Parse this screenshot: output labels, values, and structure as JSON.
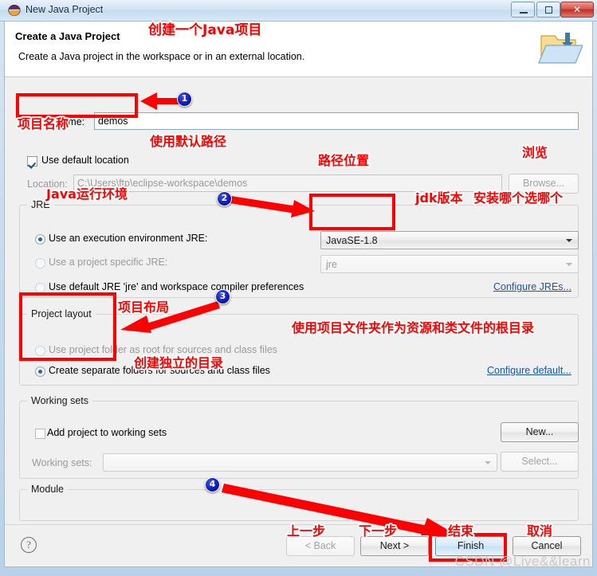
{
  "window": {
    "title": "New Java Project",
    "icon": "eclipse-java-icon",
    "buttons": {
      "minimize": "minimize-button",
      "maximize": "maximize-button",
      "close": "close-button",
      "close_glyph": "✕"
    }
  },
  "header": {
    "title": "Create a Java Project",
    "description": "Create a Java project in the workspace or in an external location.",
    "icon": "new-java-project-folder-icon"
  },
  "form": {
    "project_name_label": "Project name:",
    "project_name_value": "demos",
    "project_name_placeholder": "",
    "use_default_location_label": "Use default location",
    "use_default_location_checked": true,
    "location_label": "Location:",
    "location_value": "C:\\Users\\ftp\\eclipse-workspace\\demos",
    "browse_label": "Browse..."
  },
  "jre": {
    "group_title": "JRE",
    "options": [
      {
        "label": "Use an execution environment JRE:",
        "selected": true
      },
      {
        "label": "Use a project specific JRE:",
        "selected": false
      },
      {
        "label": "Use default JRE 'jre' and workspace compiler preferences",
        "selected": false
      }
    ],
    "execution_env_value": "JavaSE-1.8",
    "project_jre_value": "jre",
    "configure_link": "Configure JREs..."
  },
  "project_layout": {
    "group_title": "Project layout",
    "options": [
      {
        "label": "Use project folder as root for sources and class files",
        "selected": false
      },
      {
        "label": "Create separate folders for sources and class files",
        "selected": true
      }
    ],
    "configure_link": "Configure default..."
  },
  "working_sets": {
    "group_title": "Working sets",
    "add_label": "Add project to working sets",
    "add_checked": false,
    "new_label": "New...",
    "sets_label": "Working sets:",
    "sets_value": "",
    "select_label": "Select..."
  },
  "module": {
    "group_title": "Module"
  },
  "footer": {
    "help_glyph": "?",
    "back_label": "< Back",
    "next_label": "Next >",
    "finish_label": "Finish",
    "cancel_label": "Cancel"
  },
  "annotations": {
    "color": "#ff0000",
    "badge_color": "#1018b8",
    "items": [
      {
        "id": "a-create-java-project",
        "text": "创建一个Java项目"
      },
      {
        "id": "a-project-name",
        "text": "项目名称"
      },
      {
        "id": "a-default-path",
        "text": "使用默认路径"
      },
      {
        "id": "a-path-location",
        "text": "路径位置"
      },
      {
        "id": "a-browse",
        "text": "浏览"
      },
      {
        "id": "a-java-runtime",
        "text": "Java运行环境"
      },
      {
        "id": "a-jdk-version",
        "text": "jdk版本"
      },
      {
        "id": "a-install-which",
        "text": "安装哪个选哪个"
      },
      {
        "id": "a-project-layout",
        "text": "项目布局"
      },
      {
        "id": "a-use-project-folder",
        "text": "使用项目文件夹作为资源和类文件的根目录"
      },
      {
        "id": "a-separate-folders",
        "text": "创建独立的目录"
      },
      {
        "id": "a-prev-step",
        "text": "上一步"
      },
      {
        "id": "a-next-step",
        "text": "下一步"
      },
      {
        "id": "a-finish",
        "text": "结束"
      },
      {
        "id": "a-cancel",
        "text": "取消"
      }
    ],
    "badges": [
      "1",
      "2",
      "3",
      "4"
    ]
  },
  "watermark": "CSDN @Live&&learn"
}
